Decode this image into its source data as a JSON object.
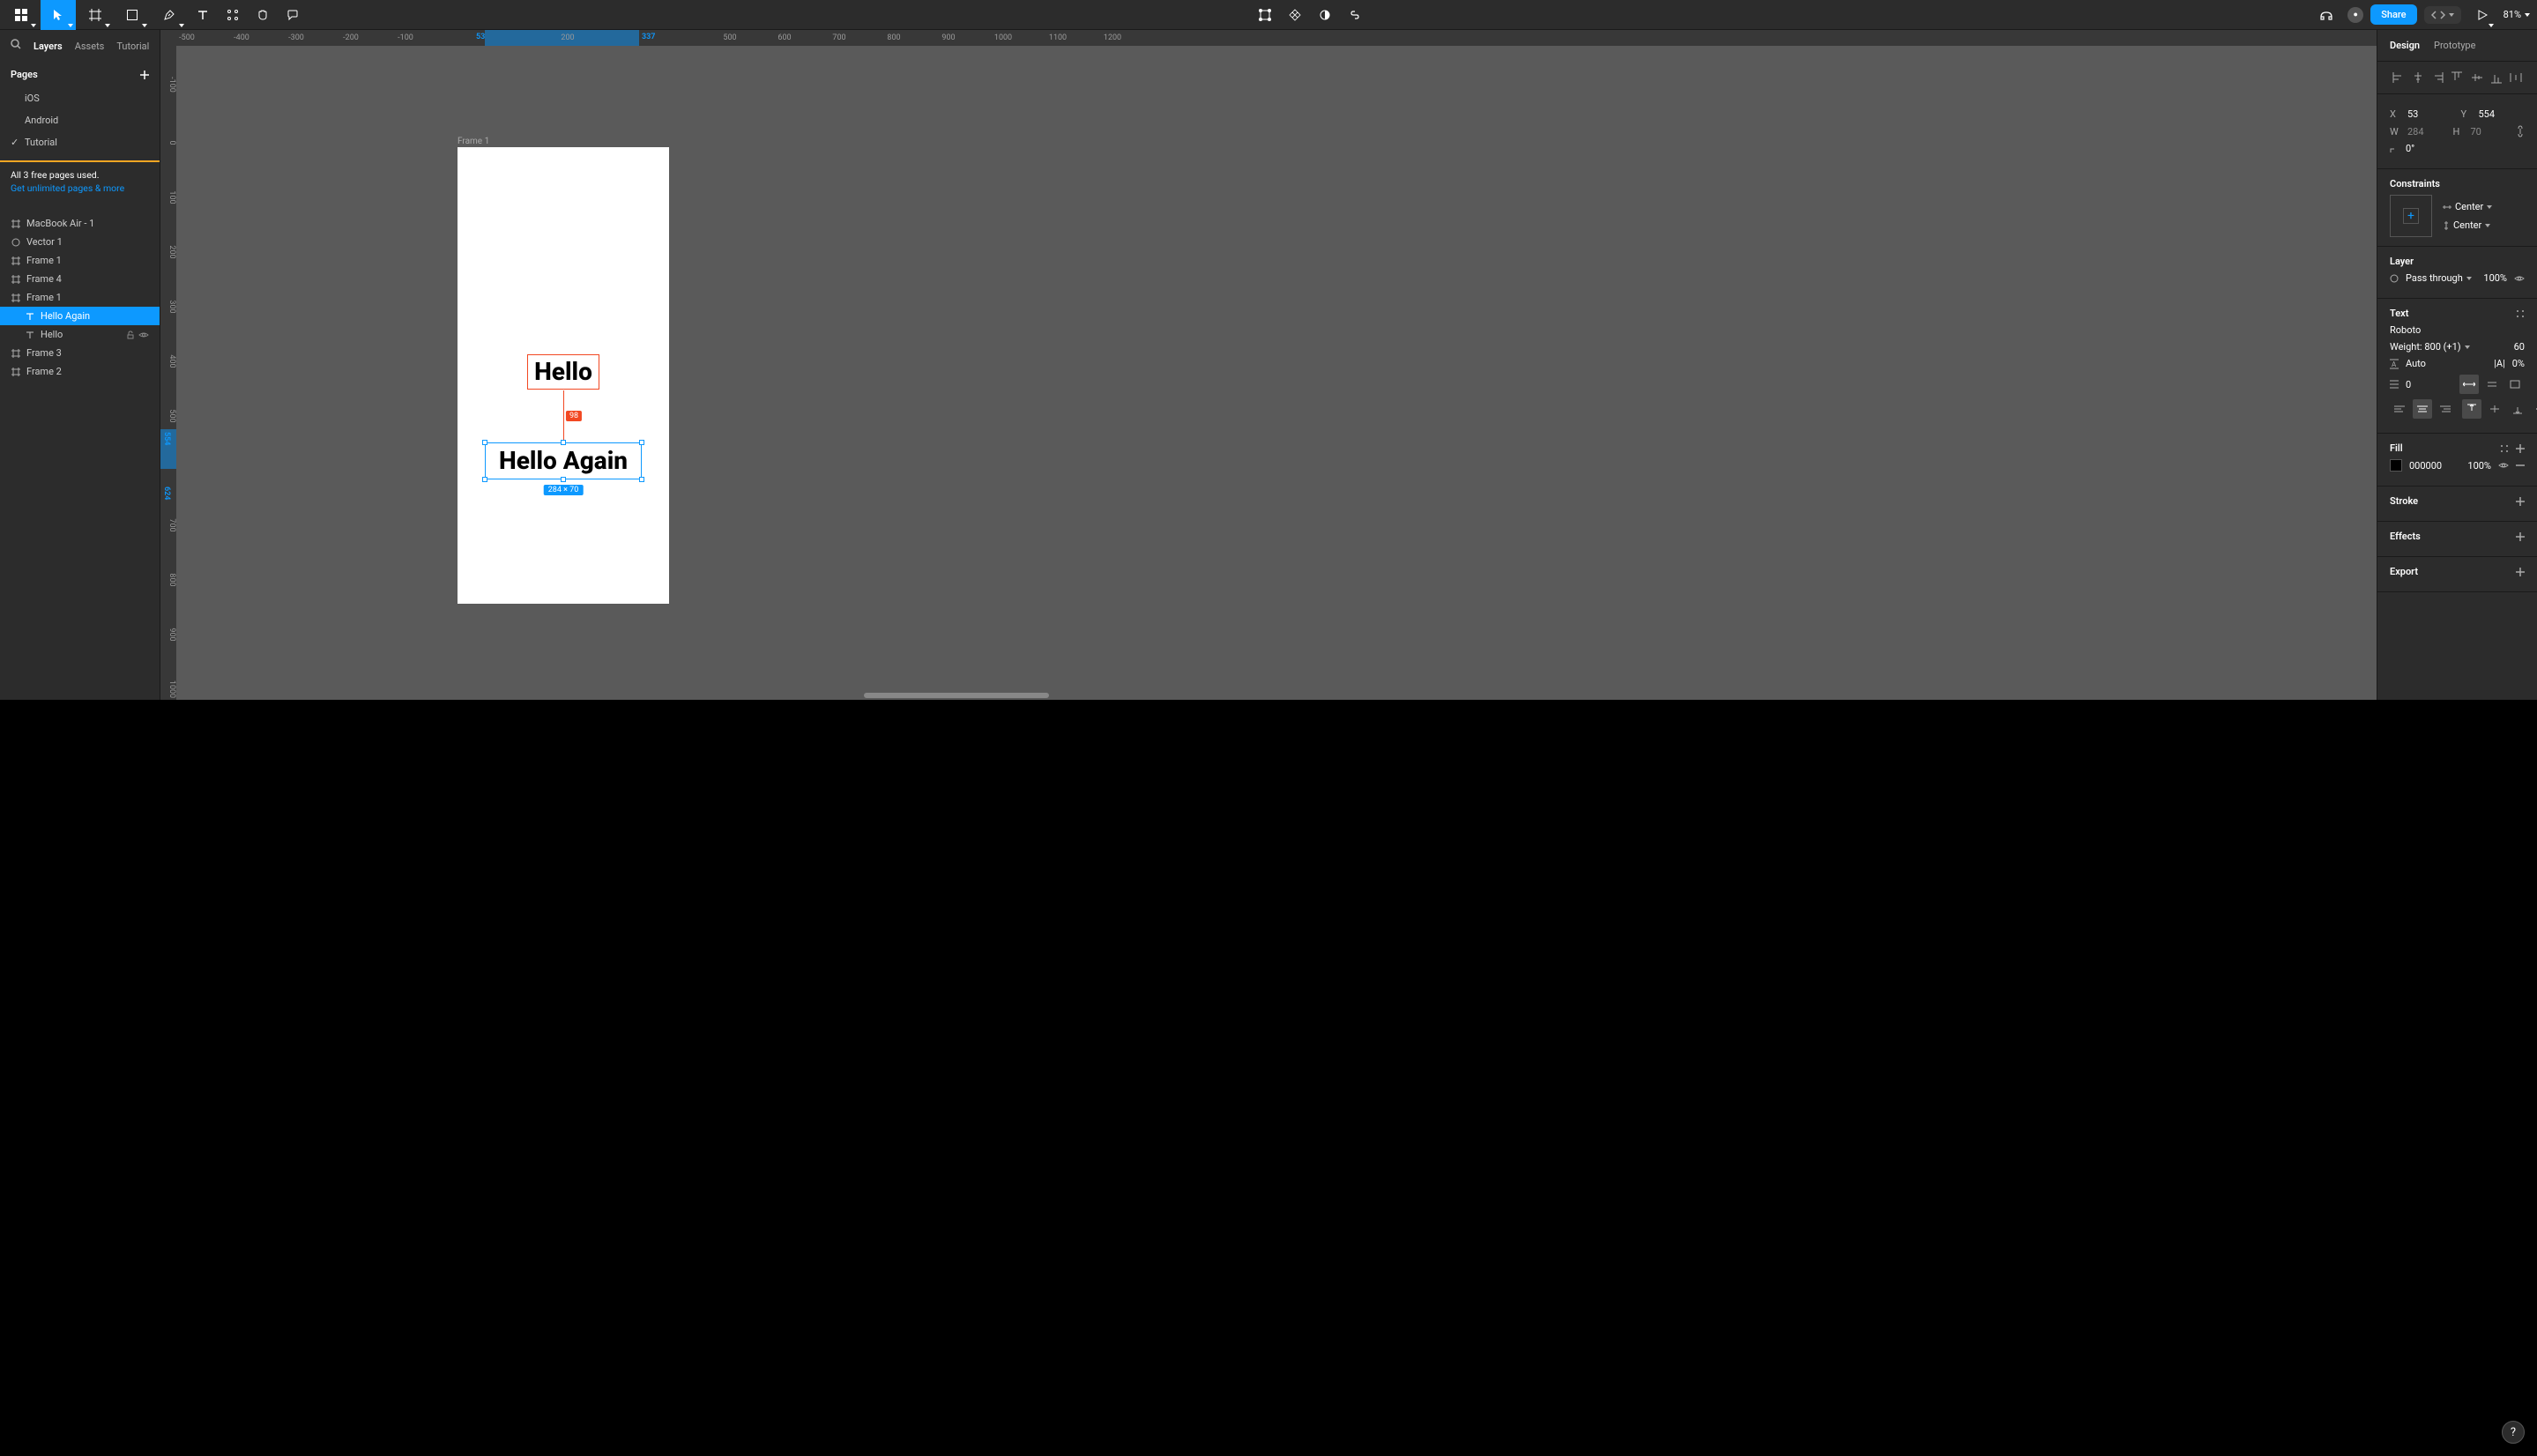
{
  "toolbar": {
    "share": "Share",
    "zoom": "81%"
  },
  "leftPanel": {
    "tabs": {
      "layers": "Layers",
      "assets": "Assets"
    },
    "tutorial": "Tutorial",
    "pagesHeader": "Pages",
    "pages": [
      "iOS",
      "Android",
      "Tutorial"
    ],
    "activePage": 2,
    "promo": {
      "line1": "All 3 free pages used.",
      "link": "Get unlimited pages & more"
    },
    "layers": [
      {
        "name": "MacBook Air - 1",
        "type": "frame",
        "indent": 0
      },
      {
        "name": "Vector 1",
        "type": "vector",
        "indent": 0
      },
      {
        "name": "Frame 1",
        "type": "frame",
        "indent": 0
      },
      {
        "name": "Frame 4",
        "type": "frame",
        "indent": 0
      },
      {
        "name": "Frame 1",
        "type": "frame",
        "indent": 0,
        "expanded": true
      },
      {
        "name": "Hello Again",
        "type": "text",
        "indent": 1,
        "selected": true
      },
      {
        "name": "Hello",
        "type": "text",
        "indent": 1,
        "actions": true
      },
      {
        "name": "Frame 3",
        "type": "frame",
        "indent": 0
      },
      {
        "name": "Frame 2",
        "type": "frame",
        "indent": 0
      }
    ]
  },
  "canvas": {
    "frameLabel": "Frame 1",
    "textHello": "Hello",
    "textHelloAgain": "Hello Again",
    "measureDistance": "98",
    "selectionSize": "284 × 70",
    "rulerH": [
      "-500",
      "-400",
      "-300",
      "-200",
      "-100",
      "53",
      "200",
      "337",
      "500",
      "600",
      "700",
      "800",
      "900",
      "1000",
      "1100",
      "1200"
    ],
    "rulerV": [
      "-100",
      "0",
      "100",
      "200",
      "300",
      "400",
      "500",
      "554",
      "624",
      "700",
      "800",
      "900",
      "1000"
    ],
    "selStartH": "53",
    "selEndH": "337",
    "selStartV": "554",
    "selEndV": "624"
  },
  "rightPanel": {
    "tabs": {
      "design": "Design",
      "prototype": "Prototype"
    },
    "position": {
      "x": "53",
      "y": "554",
      "w": "284",
      "h": "70",
      "rotation": "0°"
    },
    "constraints": {
      "title": "Constraints",
      "h": "Center",
      "v": "Center"
    },
    "layer": {
      "title": "Layer",
      "blend": "Pass through",
      "opacity": "100%"
    },
    "text": {
      "title": "Text",
      "font": "Roboto",
      "weight": "Weight: 800 (+1)",
      "size": "60",
      "lineHeight": "Auto",
      "letterSpacing": "0%",
      "paragraph": "0"
    },
    "fill": {
      "title": "Fill",
      "color": "000000",
      "opacity": "100%"
    },
    "stroke": {
      "title": "Stroke"
    },
    "effects": {
      "title": "Effects"
    },
    "export": {
      "title": "Export"
    }
  }
}
